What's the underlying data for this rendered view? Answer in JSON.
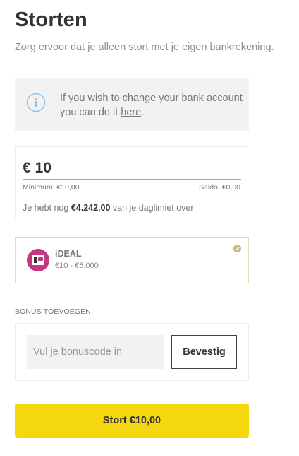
{
  "page": {
    "title": "Storten",
    "subtitle": "Zorg ervoor dat je alleen stort met je eigen bankrekening."
  },
  "info": {
    "text_before_link": "If you wish to change your bank account you can do it ",
    "link": "here",
    "text_after_link": ".",
    "icon": "info-icon"
  },
  "amount": {
    "value": "€ 10",
    "minimum": "Minimum: €10,00",
    "saldo": "Saldo: €0,00",
    "limit_prefix": "Je hebt nog ",
    "limit_value": "€4.242,00",
    "limit_suffix": " van je daglimiet over"
  },
  "payment_method": {
    "name": "iDEAL",
    "range": "€10 - €5.000",
    "selected": true,
    "logo_color": "#c5387f"
  },
  "bonus": {
    "label": "BONUS TOEVOEGEN",
    "placeholder": "Vul je bonuscode in",
    "confirm_label": "Bevestig"
  },
  "submit": {
    "label": "Stort €10,00",
    "color": "#f5d70e"
  }
}
